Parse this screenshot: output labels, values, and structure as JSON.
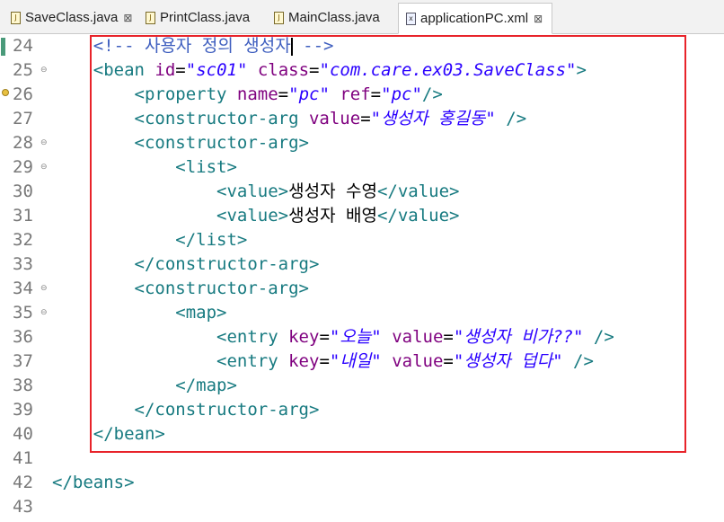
{
  "tabs": [
    {
      "label": "SaveClass.java",
      "icon": "java-file-icon",
      "close": "⊠",
      "active": false
    },
    {
      "label": "PrintClass.java",
      "icon": "java-file-icon",
      "close": "",
      "active": false
    },
    {
      "label": "MainClass.java",
      "icon": "java-file-icon",
      "close": "",
      "active": false
    },
    {
      "label": "applicationPC.xml",
      "icon": "xml-file-icon",
      "close": "⊠",
      "active": true
    }
  ],
  "lines": [
    {
      "n": "24",
      "indent": "    ",
      "parts": [
        {
          "t": "<!-- 사용자 정의 생성자",
          "c": "cmt"
        },
        {
          "t": "|",
          "c": "cursor"
        },
        {
          "t": " -->",
          "c": "cmt"
        }
      ],
      "marker": "change"
    },
    {
      "n": "25",
      "indent": "    ",
      "fold": true,
      "parts": [
        {
          "t": "<bean ",
          "c": "tag"
        },
        {
          "t": "id",
          "c": "attr"
        },
        {
          "t": "=",
          "c": "punct"
        },
        {
          "t": "\"sc01\"",
          "c": "val"
        },
        {
          "t": " ",
          "c": "punct"
        },
        {
          "t": "class",
          "c": "attr"
        },
        {
          "t": "=",
          "c": "punct"
        },
        {
          "t": "\"com.care.ex03.SaveClass\"",
          "c": "val"
        },
        {
          "t": ">",
          "c": "tag"
        }
      ]
    },
    {
      "n": "26",
      "indent": "        ",
      "marker": "warn",
      "parts": [
        {
          "t": "<property ",
          "c": "tag"
        },
        {
          "t": "name",
          "c": "attr"
        },
        {
          "t": "=",
          "c": "punct"
        },
        {
          "t": "\"pc\"",
          "c": "val"
        },
        {
          "t": " ",
          "c": "punct"
        },
        {
          "t": "ref",
          "c": "attr"
        },
        {
          "t": "=",
          "c": "punct"
        },
        {
          "t": "\"pc\"",
          "c": "val"
        },
        {
          "t": "/>",
          "c": "tag"
        }
      ]
    },
    {
      "n": "27",
      "indent": "        ",
      "parts": [
        {
          "t": "<constructor-arg ",
          "c": "tag"
        },
        {
          "t": "value",
          "c": "attr"
        },
        {
          "t": "=",
          "c": "punct"
        },
        {
          "t": "\"생성자 홍길동\"",
          "c": "val"
        },
        {
          "t": " />",
          "c": "tag"
        }
      ]
    },
    {
      "n": "28",
      "indent": "        ",
      "fold": true,
      "parts": [
        {
          "t": "<constructor-arg>",
          "c": "tag"
        }
      ]
    },
    {
      "n": "29",
      "indent": "            ",
      "fold": true,
      "parts": [
        {
          "t": "<list>",
          "c": "tag"
        }
      ]
    },
    {
      "n": "30",
      "indent": "                ",
      "parts": [
        {
          "t": "<value>",
          "c": "tag"
        },
        {
          "t": "생성자 수영",
          "c": "txt"
        },
        {
          "t": "</value>",
          "c": "tag"
        }
      ]
    },
    {
      "n": "31",
      "indent": "                ",
      "parts": [
        {
          "t": "<value>",
          "c": "tag"
        },
        {
          "t": "생성자 배영",
          "c": "txt"
        },
        {
          "t": "</value>",
          "c": "tag"
        }
      ]
    },
    {
      "n": "32",
      "indent": "            ",
      "parts": [
        {
          "t": "</list>",
          "c": "tag"
        }
      ]
    },
    {
      "n": "33",
      "indent": "        ",
      "parts": [
        {
          "t": "</constructor-arg>",
          "c": "tag"
        }
      ]
    },
    {
      "n": "34",
      "indent": "        ",
      "fold": true,
      "parts": [
        {
          "t": "<constructor-arg>",
          "c": "tag"
        }
      ]
    },
    {
      "n": "35",
      "indent": "            ",
      "fold": true,
      "parts": [
        {
          "t": "<map>",
          "c": "tag"
        }
      ]
    },
    {
      "n": "36",
      "indent": "                ",
      "parts": [
        {
          "t": "<entry ",
          "c": "tag"
        },
        {
          "t": "key",
          "c": "attr"
        },
        {
          "t": "=",
          "c": "punct"
        },
        {
          "t": "\"오늘\"",
          "c": "val"
        },
        {
          "t": " ",
          "c": "punct"
        },
        {
          "t": "value",
          "c": "attr"
        },
        {
          "t": "=",
          "c": "punct"
        },
        {
          "t": "\"생성자 비가??\"",
          "c": "val"
        },
        {
          "t": " />",
          "c": "tag"
        }
      ]
    },
    {
      "n": "37",
      "indent": "                ",
      "parts": [
        {
          "t": "<entry ",
          "c": "tag"
        },
        {
          "t": "key",
          "c": "attr"
        },
        {
          "t": "=",
          "c": "punct"
        },
        {
          "t": "\"내일\"",
          "c": "val"
        },
        {
          "t": " ",
          "c": "punct"
        },
        {
          "t": "value",
          "c": "attr"
        },
        {
          "t": "=",
          "c": "punct"
        },
        {
          "t": "\"생성자 덥다\"",
          "c": "val"
        },
        {
          "t": " />",
          "c": "tag"
        }
      ]
    },
    {
      "n": "38",
      "indent": "            ",
      "parts": [
        {
          "t": "</map>",
          "c": "tag"
        }
      ]
    },
    {
      "n": "39",
      "indent": "        ",
      "parts": [
        {
          "t": "</constructor-arg>",
          "c": "tag"
        }
      ]
    },
    {
      "n": "40",
      "indent": "    ",
      "parts": [
        {
          "t": "</bean>",
          "c": "tag"
        }
      ]
    },
    {
      "n": "41",
      "indent": "",
      "parts": []
    },
    {
      "n": "42",
      "indent": "",
      "parts": [
        {
          "t": "</beans>",
          "c": "tag"
        }
      ]
    },
    {
      "n": "43",
      "indent": "",
      "parts": []
    }
  ],
  "colors": {
    "highlight_border": "#e8232a",
    "tag": "#177a80",
    "attribute": "#7f007f",
    "value": "#2a00ff",
    "comment": "#3f5fbf"
  }
}
